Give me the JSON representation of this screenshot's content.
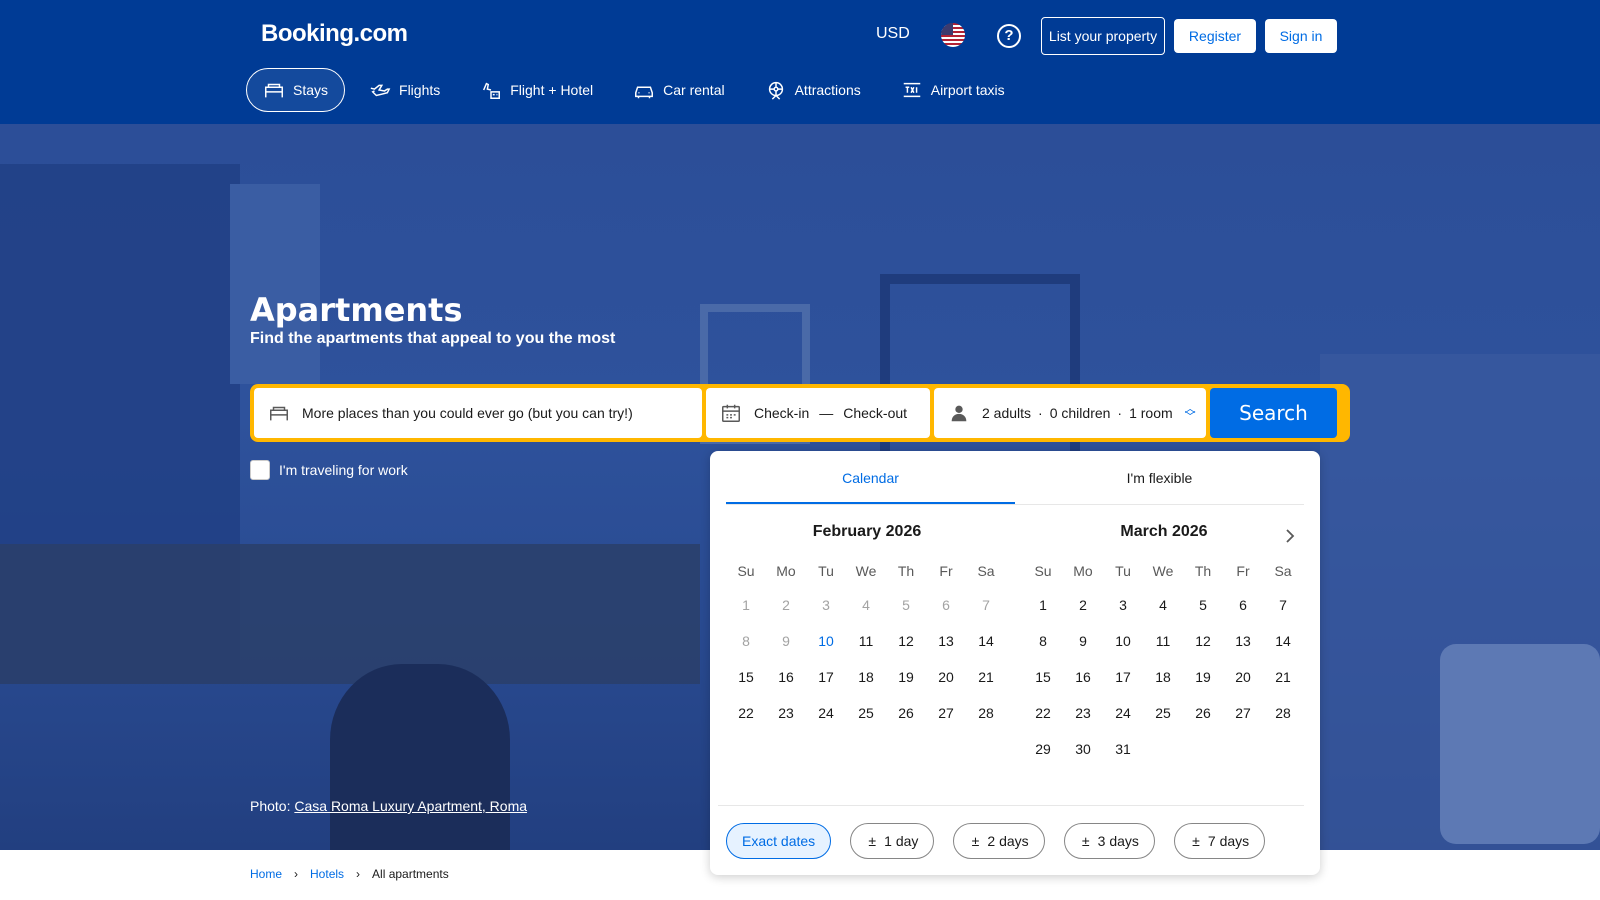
{
  "header": {
    "logo": "Booking.com",
    "currency": "USD",
    "flag_icon": "us-flag-icon",
    "help_icon": "question-circle-icon",
    "list_property": "List your property",
    "register": "Register",
    "sign_in": "Sign in",
    "colors": {
      "background": "#003b95",
      "primary": "#006ce4",
      "accent": "#ffb700"
    }
  },
  "nav": [
    {
      "label": "Stays",
      "icon": "bed-icon",
      "active": true
    },
    {
      "label": "Flights",
      "icon": "plane-icon"
    },
    {
      "label": "Flight + Hotel",
      "icon": "plane-hotel-icon"
    },
    {
      "label": "Car rental",
      "icon": "car-icon"
    },
    {
      "label": "Attractions",
      "icon": "attractions-icon"
    },
    {
      "label": "Airport taxis",
      "icon": "taxi-icon"
    }
  ],
  "hero": {
    "title": "Apartments",
    "subtitle": "Find the apartments that appeal to you the most",
    "photo_prefix": "Photo:",
    "photo_link": "Casa Roma Luxury Apartment, Roma"
  },
  "search": {
    "destination_placeholder": "More places than you could ever go (but you can try!)",
    "checkin": "Check-in",
    "dash": "—",
    "checkout": "Check-out",
    "adults": "2 adults",
    "children": "0 children",
    "rooms": "1 room",
    "dot": "·",
    "button": "Search",
    "work_label": "I'm traveling for work"
  },
  "calendar": {
    "tabs": [
      "Calendar",
      "I'm flexible"
    ],
    "weekdays": [
      "Su",
      "Mo",
      "Tu",
      "We",
      "Th",
      "Fr",
      "Sa"
    ],
    "months": [
      {
        "title": "February 2026",
        "start_offset": 0,
        "days": 28,
        "past_until": 9,
        "today": 10
      },
      {
        "title": "March 2026",
        "start_offset": 0,
        "days": 31,
        "past_until": 0,
        "today": 0
      }
    ],
    "chips": [
      {
        "label": "Exact dates",
        "active": true,
        "prefix": ""
      },
      {
        "label": "1 day",
        "prefix": "±"
      },
      {
        "label": "2 days",
        "prefix": "±"
      },
      {
        "label": "3 days",
        "prefix": "±"
      },
      {
        "label": "7 days",
        "prefix": "±"
      }
    ]
  },
  "breadcrumb": [
    "Home",
    "Hotels",
    "All apartments"
  ],
  "breadcrumb_sep": "›"
}
